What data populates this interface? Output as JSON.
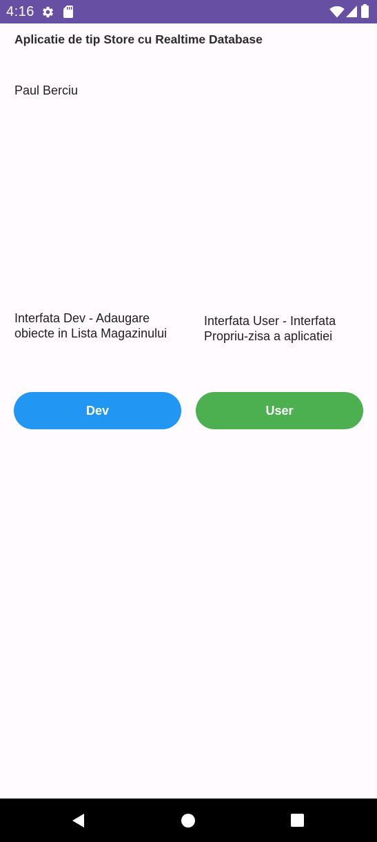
{
  "status_bar": {
    "time": "4:16",
    "icons": [
      "gear-icon",
      "sd-card-icon",
      "wifi-icon",
      "signal-icon",
      "battery-icon"
    ]
  },
  "app": {
    "title": "Aplicatie de tip Store cu Realtime Database",
    "author": "Paul Berciu"
  },
  "sections": {
    "dev_description": "Interfata Dev - Adaugare obiecte in Lista Magazinului",
    "user_description": "Interfata User - Interfata Propriu-zisa a aplicatiei"
  },
  "buttons": {
    "dev_label": "Dev",
    "user_label": "User"
  },
  "colors": {
    "status_bar": "#6750a4",
    "background": "#fffbfe",
    "dev_button": "#2196f3",
    "user_button": "#4caf50",
    "nav_bar": "#000000"
  },
  "nav_bar": {
    "icons": [
      "back-icon",
      "home-icon",
      "recents-icon"
    ]
  }
}
